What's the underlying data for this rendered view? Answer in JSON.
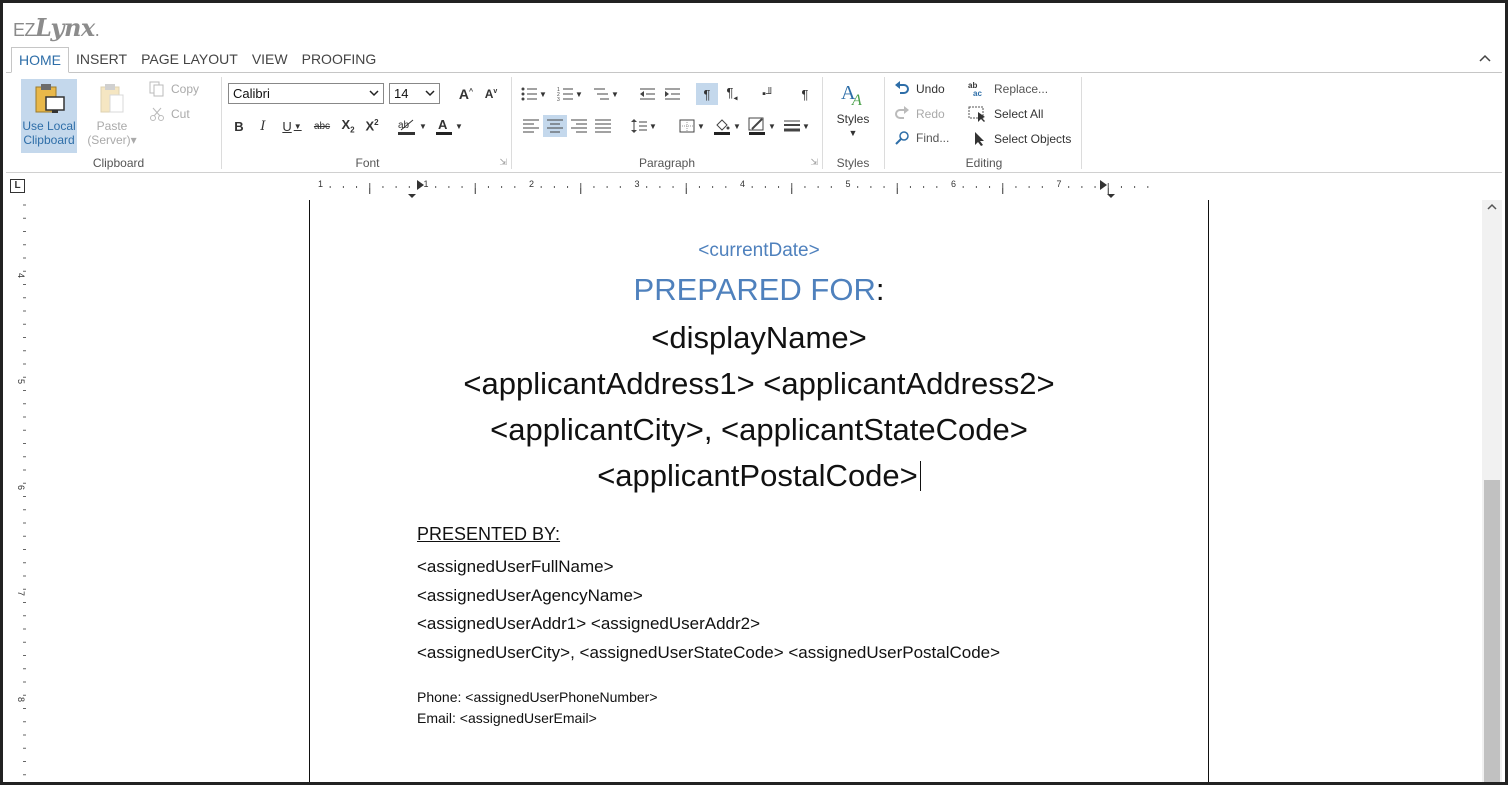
{
  "logo": {
    "ez": "EZ",
    "lynx": "Lynx",
    "dot": "."
  },
  "tabs": [
    {
      "label": "HOME",
      "active": true
    },
    {
      "label": "INSERT"
    },
    {
      "label": "PAGE LAYOUT"
    },
    {
      "label": "VIEW"
    },
    {
      "label": "PROOFING"
    }
  ],
  "collapse_icon": "^",
  "clipboard": {
    "use_local": "Use Local Clipboard",
    "use_local_l1": "Use Local",
    "use_local_l2": "Clipboard",
    "paste_l1": "Paste",
    "paste_l2": "(Server)",
    "copy": "Copy",
    "cut": "Cut",
    "label": "Clipboard"
  },
  "font": {
    "family": "Calibri",
    "size": "14",
    "label": "Font"
  },
  "paragraph": {
    "label": "Paragraph"
  },
  "styles": {
    "button": "Styles",
    "label": "Styles"
  },
  "editing": {
    "undo": "Undo",
    "redo": "Redo",
    "find": "Find...",
    "replace": "Replace...",
    "select_all": "Select All",
    "select_objects": "Select Objects",
    "label": "Editing"
  },
  "ruler": {
    "numbers": [
      "1",
      "1",
      "2",
      "3",
      "4",
      "5",
      "6",
      "7"
    ]
  },
  "vruler": {
    "numbers": [
      "4",
      "5",
      "6",
      "7",
      "8"
    ]
  },
  "document": {
    "date": "<currentDate>",
    "prepared_for": "PREPARED FOR",
    "colon": ":",
    "display_name": "<displayName>",
    "address": "<applicantAddress1> <applicantAddress2>",
    "city_state": "<applicantCity>, <applicantStateCode>",
    "postal": "<applicantPostalCode>",
    "presented_by": "PRESENTED BY:",
    "user_full_name": "<assignedUserFullName>",
    "agency_name": "<assignedUserAgencyName>",
    "user_addr": "<assignedUserAddr1> <assignedUserAddr2>",
    "user_city": "<assignedUserCity>, <assignedUserStateCode> <assignedUserPostalCode>",
    "phone": "Phone: <assignedUserPhoneNumber>",
    "email": "Email: <assignedUserEmail>"
  },
  "colors": {
    "accent": "#4f81bd",
    "tab_active": "#2e6ea8",
    "highlight": "#c4d8ec"
  }
}
